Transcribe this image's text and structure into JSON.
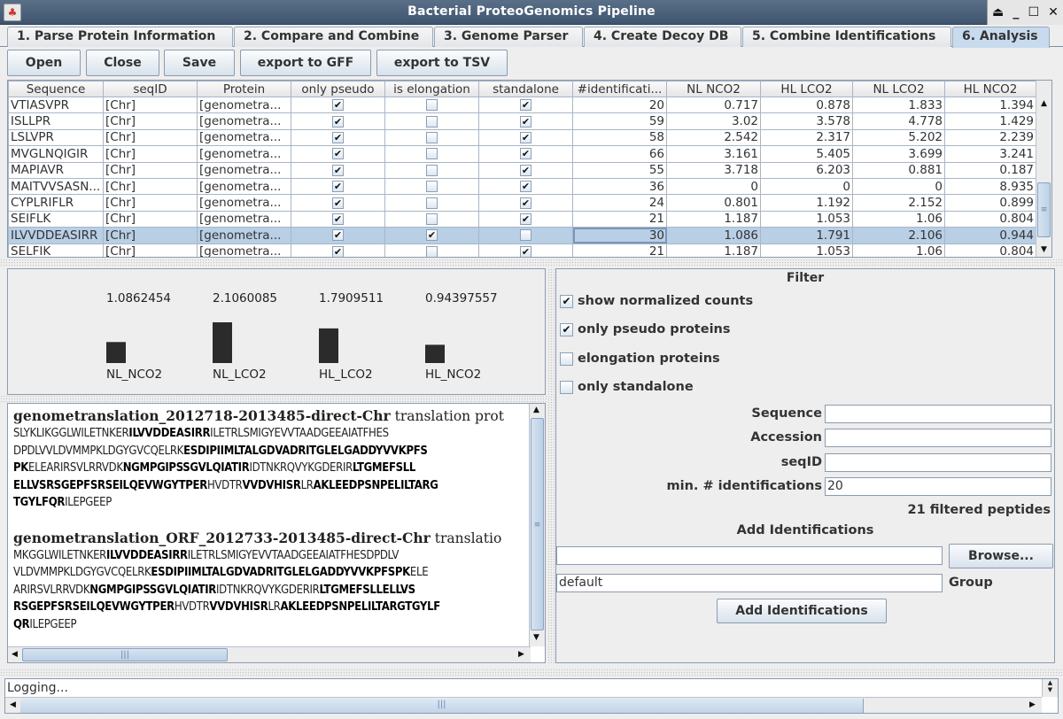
{
  "window": {
    "title": "Bacterial ProteoGenomics Pipeline",
    "controls": [
      "eject",
      "minimize",
      "maximize",
      "close"
    ]
  },
  "tabs": [
    {
      "label": "1. Parse Protein Information",
      "active": false
    },
    {
      "label": "2. Compare and Combine",
      "active": false
    },
    {
      "label": "3. Genome Parser",
      "active": false
    },
    {
      "label": "4. Create Decoy DB",
      "active": false
    },
    {
      "label": "5. Combine Identifications",
      "active": false
    },
    {
      "label": "6. Analysis",
      "active": true
    }
  ],
  "toolbar": {
    "open_label": "Open",
    "close_label": "Close",
    "save_label": "Save",
    "export_gff_label": "export to GFF",
    "export_tsv_label": "export to TSV"
  },
  "table": {
    "columns": [
      "Sequence",
      "seqID",
      "Protein",
      "only pseudo",
      "is elongation",
      "standalone",
      "#identificati...",
      "NL NCO2",
      "HL LCO2",
      "NL LCO2",
      "HL NCO2"
    ],
    "rows": [
      {
        "sequence": "VTIASVPR",
        "seqid": "[Chr]",
        "protein": "[genometra...",
        "only_pseudo": true,
        "is_elongation": false,
        "standalone": true,
        "identifications": "20",
        "nl_nco2": "0.717",
        "hl_lco2": "0.878",
        "nl_lco2": "1.833",
        "hl_nco2": "1.394",
        "selected": false
      },
      {
        "sequence": "ISLLPR",
        "seqid": "[Chr]",
        "protein": "[genometra...",
        "only_pseudo": true,
        "is_elongation": false,
        "standalone": true,
        "identifications": "59",
        "nl_nco2": "3.02",
        "hl_lco2": "3.578",
        "nl_lco2": "4.778",
        "hl_nco2": "1.429",
        "selected": false
      },
      {
        "sequence": "LSLVPR",
        "seqid": "[Chr]",
        "protein": "[genometra...",
        "only_pseudo": true,
        "is_elongation": false,
        "standalone": true,
        "identifications": "58",
        "nl_nco2": "2.542",
        "hl_lco2": "2.317",
        "nl_lco2": "5.202",
        "hl_nco2": "2.239",
        "selected": false
      },
      {
        "sequence": "MVGLNQIGIR",
        "seqid": "[Chr]",
        "protein": "[genometra...",
        "only_pseudo": true,
        "is_elongation": false,
        "standalone": true,
        "identifications": "66",
        "nl_nco2": "3.161",
        "hl_lco2": "5.405",
        "nl_lco2": "3.699",
        "hl_nco2": "3.241",
        "selected": false
      },
      {
        "sequence": "MAPIAVR",
        "seqid": "[Chr]",
        "protein": "[genometra...",
        "only_pseudo": true,
        "is_elongation": false,
        "standalone": true,
        "identifications": "55",
        "nl_nco2": "3.718",
        "hl_lco2": "6.203",
        "nl_lco2": "0.881",
        "hl_nco2": "0.187",
        "selected": false
      },
      {
        "sequence": "MAITVVSASN...",
        "seqid": "[Chr]",
        "protein": "[genometra...",
        "only_pseudo": true,
        "is_elongation": false,
        "standalone": true,
        "identifications": "36",
        "nl_nco2": "0",
        "hl_lco2": "0",
        "nl_lco2": "0",
        "hl_nco2": "8.935",
        "selected": false
      },
      {
        "sequence": "CYPLRIFLR",
        "seqid": "[Chr]",
        "protein": "[genometra...",
        "only_pseudo": true,
        "is_elongation": false,
        "standalone": true,
        "identifications": "24",
        "nl_nco2": "0.801",
        "hl_lco2": "1.192",
        "nl_lco2": "2.152",
        "hl_nco2": "0.899",
        "selected": false
      },
      {
        "sequence": "SEIFLK",
        "seqid": "[Chr]",
        "protein": "[genometra...",
        "only_pseudo": true,
        "is_elongation": false,
        "standalone": true,
        "identifications": "21",
        "nl_nco2": "1.187",
        "hl_lco2": "1.053",
        "nl_lco2": "1.06",
        "hl_nco2": "0.804",
        "selected": false
      },
      {
        "sequence": "ILVVDDEASIRR",
        "seqid": "[Chr]",
        "protein": "[genometra...",
        "only_pseudo": true,
        "is_elongation": true,
        "standalone": false,
        "identifications": "30",
        "nl_nco2": "1.086",
        "hl_lco2": "1.791",
        "nl_lco2": "2.106",
        "hl_nco2": "0.944",
        "selected": true
      },
      {
        "sequence": "SELFIK",
        "seqid": "[Chr]",
        "protein": "[genometra...",
        "only_pseudo": true,
        "is_elongation": false,
        "standalone": true,
        "identifications": "21",
        "nl_nco2": "1.187",
        "hl_lco2": "1.053",
        "nl_lco2": "1.06",
        "hl_nco2": "0.804",
        "selected": false
      }
    ]
  },
  "chart_data": {
    "type": "bar",
    "title": "",
    "xlabel": "",
    "ylabel": "",
    "categories": [
      "NL_NCO2",
      "NL_LCO2",
      "HL_LCO2",
      "HL_NCO2"
    ],
    "values": [
      1.0862454,
      2.1060085,
      1.7909511,
      0.94397557
    ],
    "value_labels": [
      "1.0862454",
      "2.1060085",
      "1.7909511",
      "0.94397557"
    ],
    "bar_color": "#2b2b2b",
    "grid": false,
    "legend": "none"
  },
  "sequences": [
    {
      "header_bold": "genometranslation_2012718-2013485-direct-Chr",
      "header_rest": " translation prot",
      "lines": [
        [
          {
            "t": "SLYKLIKGGLWILETNKER",
            "b": false
          },
          {
            "t": "ILVVDDEASIRR",
            "b": true
          },
          {
            "t": "ILETRLSMIGYEVVTAADGEEAIATFHES",
            "b": false
          }
        ],
        [
          {
            "t": "DPDLVVLDVMMPKLDGYGVCQELRK",
            "b": false
          },
          {
            "t": "ESDIPIIMLTALGDVADRITGLELGADDYVVKPFS",
            "b": true
          }
        ],
        [
          {
            "t": "PK",
            "b": true
          },
          {
            "t": "ELEARIRSVLRRVDK",
            "b": false
          },
          {
            "t": "NGMPGIPSSGVLQIATIR",
            "b": true
          },
          {
            "t": "IDTNKRQVYKGDERIR",
            "b": false
          },
          {
            "t": "LTGMEFSLL",
            "b": true
          }
        ],
        [
          {
            "t": "ELLVSRSGEPFSRSEILQEVWGYTPER",
            "b": true
          },
          {
            "t": "HVDTR",
            "b": false
          },
          {
            "t": "VVDVHISR",
            "b": true
          },
          {
            "t": "LR",
            "b": false
          },
          {
            "t": "AKLEEDPSNPELILTARG",
            "b": true
          }
        ],
        [
          {
            "t": "TGYLFQR",
            "b": true
          },
          {
            "t": "ILEPGEEP",
            "b": false
          }
        ]
      ]
    },
    {
      "header_bold": "genometranslation_ORF_2012733-2013485-direct-Chr",
      "header_rest": " translatio",
      "lines": [
        [
          {
            "t": "MKGGLWILETNKER",
            "b": false
          },
          {
            "t": "ILVVDDEASIRR",
            "b": true
          },
          {
            "t": "ILETRLSMIGYEVVTAADGEEAIATFHESDPDLV",
            "b": false
          }
        ],
        [
          {
            "t": "VLDVMMPKLDGYGVCQELRK",
            "b": false
          },
          {
            "t": "ESDIPIIMLTALGDVADRITGLELGADDYVVKPFSPK",
            "b": true
          },
          {
            "t": "ELE",
            "b": false
          }
        ],
        [
          {
            "t": "ARIRSVLRRVDK",
            "b": false
          },
          {
            "t": "NGMPGIPSSGVLQIATIR",
            "b": true
          },
          {
            "t": "IDTNKRQVYKGDERIR",
            "b": false
          },
          {
            "t": "LTGMEFSLLELLVS",
            "b": true
          }
        ],
        [
          {
            "t": "RSGEPFSRSEILQEVWGYTPER",
            "b": true
          },
          {
            "t": "HVDTR",
            "b": false
          },
          {
            "t": "VVDVHISR",
            "b": true
          },
          {
            "t": "LR",
            "b": false
          },
          {
            "t": "AKLEEDPSNPELILTARGTGYLF",
            "b": true
          }
        ],
        [
          {
            "t": "QR",
            "b": true
          },
          {
            "t": "ILEPGEEP",
            "b": false
          }
        ]
      ]
    }
  ],
  "filter": {
    "title": "Filter",
    "checkboxes": [
      {
        "label": "show normalized counts",
        "checked": true
      },
      {
        "label": "only pseudo proteins",
        "checked": true
      },
      {
        "label": "elongation proteins",
        "checked": false
      },
      {
        "label": "only standalone",
        "checked": false
      }
    ],
    "fields": [
      {
        "label": "Sequence",
        "value": ""
      },
      {
        "label": "Accession",
        "value": ""
      },
      {
        "label": "seqID",
        "value": ""
      },
      {
        "label": "min. # identifications",
        "value": "20"
      }
    ],
    "filtered_count": "21 filtered peptides",
    "add_identifications": {
      "title": "Add Identifications",
      "file_value": "",
      "browse_label": "Browse...",
      "group_value": "default",
      "group_label": "Group",
      "button_label": "Add Identifications"
    }
  },
  "log": {
    "text": "Logging..."
  }
}
